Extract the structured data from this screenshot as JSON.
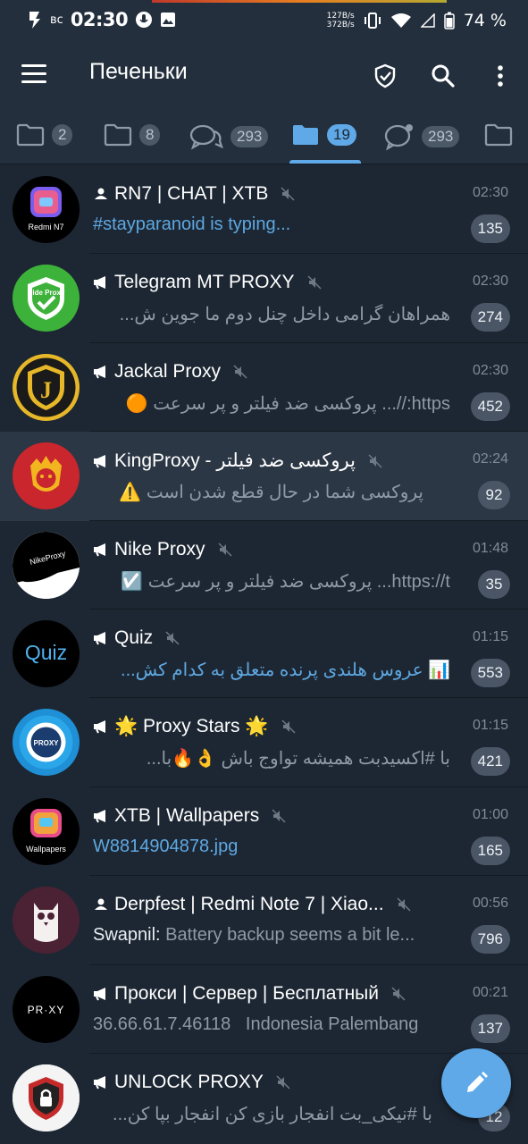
{
  "status_bar": {
    "day": "вс",
    "time": "02:30",
    "speed_up": "127B/s",
    "speed_down": "372B/s",
    "battery": "74 %"
  },
  "toolbar": {
    "title": "Печеньки",
    "icons": [
      "menu-icon",
      "shield-check-icon",
      "search-icon",
      "more-vert-icon"
    ]
  },
  "tabs": [
    {
      "icon": "folder-icon",
      "count": "2"
    },
    {
      "icon": "folder-icon",
      "count": "8"
    },
    {
      "icon": "chats-icon",
      "count": "293"
    },
    {
      "icon": "folder-icon",
      "count": "19",
      "active": true
    },
    {
      "icon": "chat-unread-icon",
      "count": "293"
    },
    {
      "icon": "folder-icon",
      "count": ""
    }
  ],
  "chats": [
    {
      "type": "group",
      "name": "RN7 | CHAT | XTB",
      "time": "02:30",
      "message": "#stayparanoid is typing...",
      "unread": "135",
      "avatar_text": "Redmi N7"
    },
    {
      "type": "channel",
      "name": "Telegram MT PROXY",
      "time": "02:30",
      "message": "همراهان گرامی داخل چنل دوم ما جوین ش...",
      "unread": "274",
      "avatar_text": "Hide Proxy"
    },
    {
      "type": "channel",
      "name": "Jackal Proxy",
      "time": "02:30",
      "message": "https://...  پروکسی ضد فیلتر و پر سرعت 🟠",
      "unread": "452",
      "avatar_text": "J"
    },
    {
      "type": "channel",
      "name": "KingProxy - پروکسی ضد فیلتر",
      "time": "02:24",
      "message": "پروکسی شما در حال قطع شدن است ⚠️",
      "unread": "92"
    },
    {
      "type": "channel",
      "name": "Nike Proxy",
      "time": "01:48",
      "message": "https://t...  پروکسی ضد فیلتر و پر سرعت ☑️",
      "unread": "35",
      "avatar_text": "NikeProxy"
    },
    {
      "type": "channel",
      "name": "Quiz",
      "time": "01:15",
      "message": "📊 عروس هلندی پرنده متعلق به کدام کش...",
      "unread": "553",
      "avatar_text": "Quiz"
    },
    {
      "type": "channel",
      "name": "🌟 Proxy Stars 🌟",
      "time": "01:15",
      "message": "با #اکسیدبت همیشه تواوج باش 👌🔥با...",
      "unread": "421",
      "avatar_text": "PROXY"
    },
    {
      "type": "channel",
      "name": "XTB | Wallpapers",
      "time": "01:00",
      "message": "W8814904878.jpg",
      "unread": "165",
      "avatar_text": "Wallpapers"
    },
    {
      "type": "group",
      "name": "Derpfest | Redmi Note 7 | Xiao...",
      "time": "00:56",
      "sender": "Swapnil:",
      "message": "Battery backup seems a bit le...",
      "unread": "796"
    },
    {
      "type": "channel",
      "name": "Прокси | Сервер | Бесплатный",
      "time": "00:21",
      "message": "36.66.61.7.46118   Indonesia Palembang",
      "unread": "137",
      "avatar_text": "PR·XY"
    },
    {
      "type": "channel",
      "name": "UNLOCK PROXY",
      "time": "",
      "message": "با #نیکی_بت انفجار بازی کن انفجار بپا کن...",
      "unread": "12"
    }
  ],
  "colors": {
    "accent": "#5fa9e8",
    "background": "#1d2733",
    "header": "#232f3d"
  }
}
